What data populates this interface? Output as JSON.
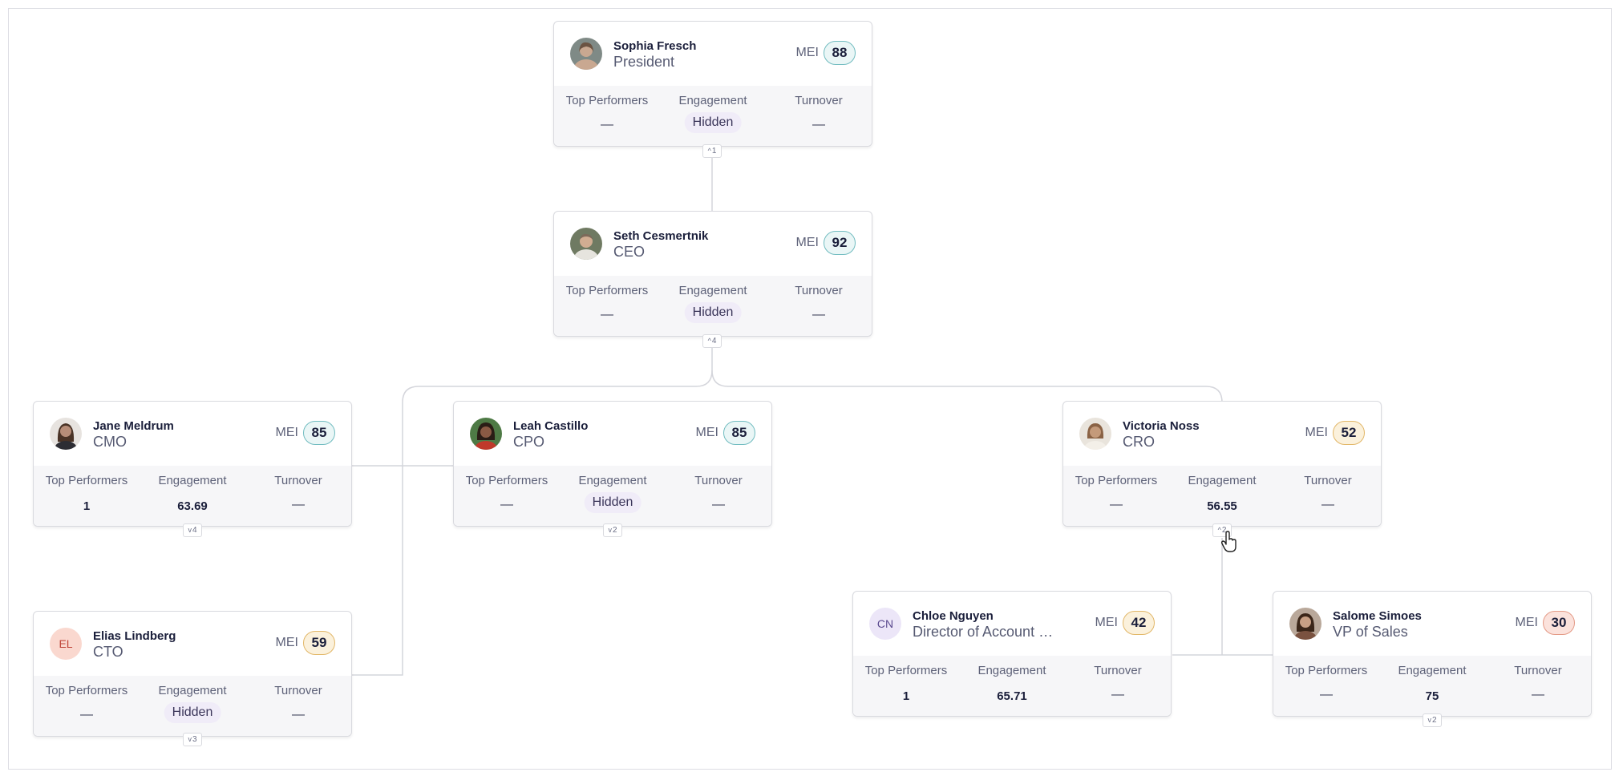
{
  "labels": {
    "mei": "MEI",
    "top_performers": "Top Performers",
    "engagement": "Engagement",
    "turnover": "Turnover"
  },
  "nodes": {
    "sophia": {
      "name": "Sophia Fresch",
      "title": "President",
      "mei": "88",
      "mei_level": "good",
      "top_performers": "—",
      "engagement": "Hidden",
      "turnover": "—",
      "toggle_count": "1",
      "toggle_icon": "chevron-up-icon",
      "avatar": "photo",
      "avatar_colors": [
        "#7f8a86",
        "#c9a891"
      ]
    },
    "seth": {
      "name": "Seth Cesmertnik",
      "title": "CEO",
      "mei": "92",
      "mei_level": "good",
      "top_performers": "—",
      "engagement": "Hidden",
      "turnover": "—",
      "toggle_count": "4",
      "toggle_icon": "chevron-up-icon",
      "avatar": "photo",
      "avatar_colors": [
        "#6f7a62",
        "#d1ad92"
      ]
    },
    "jane": {
      "name": "Jane Meldrum",
      "title": "CMO",
      "mei": "85",
      "mei_level": "good",
      "top_performers": "1",
      "engagement": "63.69",
      "turnover": "—",
      "toggle_count": "4",
      "toggle_icon": "chevron-down-icon",
      "avatar": "photo",
      "avatar_colors": [
        "#e7e3df",
        "#b78d78"
      ]
    },
    "leah": {
      "name": "Leah Castillo",
      "title": "CPO",
      "mei": "85",
      "mei_level": "good",
      "top_performers": "—",
      "engagement": "Hidden",
      "turnover": "—",
      "toggle_count": "2",
      "toggle_icon": "chevron-down-icon",
      "avatar": "photo",
      "avatar_colors": [
        "#4e7a45",
        "#8a5a44"
      ]
    },
    "victoria": {
      "name": "Victoria Noss",
      "title": "CRO",
      "mei": "52",
      "mei_level": "mid",
      "top_performers": "—",
      "engagement": "56.55",
      "turnover": "—",
      "toggle_count": "2",
      "toggle_icon": "chevron-up-icon",
      "avatar": "photo",
      "avatar_colors": [
        "#e9e4dc",
        "#c49a7a"
      ]
    },
    "elias": {
      "name": "Elias Lindberg",
      "title": "CTO",
      "mei": "59",
      "mei_level": "mid",
      "top_performers": "—",
      "engagement": "Hidden",
      "turnover": "—",
      "toggle_count": "3",
      "toggle_icon": "chevron-down-icon",
      "avatar": "initials",
      "initials": "EL",
      "avatar_colors": [
        "#fad8cf",
        "#c0463a"
      ]
    },
    "chloe": {
      "name": "Chloe Nguyen",
      "title": "Director of Account Management",
      "mei": "42",
      "mei_level": "mid",
      "top_performers": "1",
      "engagement": "65.71",
      "turnover": "—",
      "avatar": "initials",
      "initials": "CN",
      "avatar_colors": [
        "#ece6f8",
        "#5b4a8f"
      ]
    },
    "salome": {
      "name": "Salome Simoes",
      "title": "VP of Sales",
      "mei": "30",
      "mei_level": "low",
      "top_performers": "—",
      "engagement": "75",
      "turnover": "—",
      "toggle_count": "2",
      "toggle_icon": "chevron-down-icon",
      "avatar": "photo",
      "avatar_colors": [
        "#b9a89a",
        "#7a5240"
      ]
    }
  },
  "colors": {
    "connector": "#d4d5db",
    "mei_good": "#71bcc0",
    "mei_mid": "#e2b768",
    "mei_low": "#e49a86"
  }
}
